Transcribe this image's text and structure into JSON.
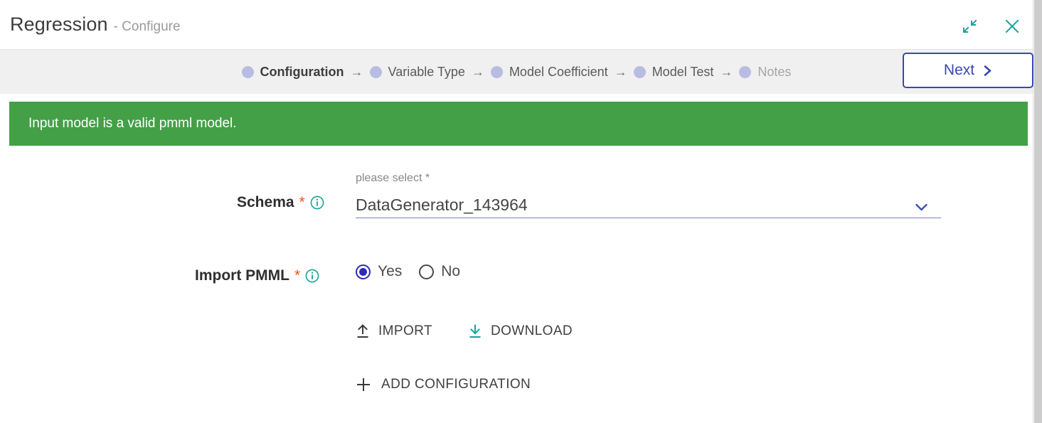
{
  "window": {
    "title": "Regression",
    "subtitle": "- Configure",
    "minimize_icon": "collapse-arrows-icon",
    "close_icon": "close-icon"
  },
  "stepper": {
    "steps": [
      {
        "label": "Configuration",
        "state": "active"
      },
      {
        "label": "Variable Type",
        "state": "default"
      },
      {
        "label": "Model Coefficient",
        "state": "default"
      },
      {
        "label": "Model Test",
        "state": "default"
      },
      {
        "label": "Notes",
        "state": "muted"
      }
    ],
    "arrow": "→",
    "next_label": "Next",
    "next_chevron": "❯"
  },
  "alert": {
    "message": "Input model is a valid pmml model.",
    "type": "success",
    "color": "#43a047"
  },
  "form": {
    "schema": {
      "label": "Schema",
      "required_marker": "*",
      "info_icon": "info-icon",
      "floating_label": "please select *",
      "value": "DataGenerator_143964",
      "chevron_icon": "chevron-down-icon"
    },
    "import_pmml": {
      "label": "Import PMML",
      "required_marker": "*",
      "info_icon": "info-icon",
      "options": [
        {
          "label": "Yes",
          "selected": true
        },
        {
          "label": "No",
          "selected": false
        }
      ]
    },
    "actions": [
      {
        "label": "IMPORT",
        "icon": "upload-icon"
      },
      {
        "label": "DOWNLOAD",
        "icon": "download-icon"
      }
    ],
    "add_configuration": {
      "label": "ADD CONFIGURATION",
      "icon": "plus-icon"
    }
  },
  "colors": {
    "accent_teal": "#17a398",
    "accent_blue": "#3a46b0",
    "success_green": "#43a047",
    "required_red": "#f4511e",
    "step_dot": "#b9bce2"
  }
}
